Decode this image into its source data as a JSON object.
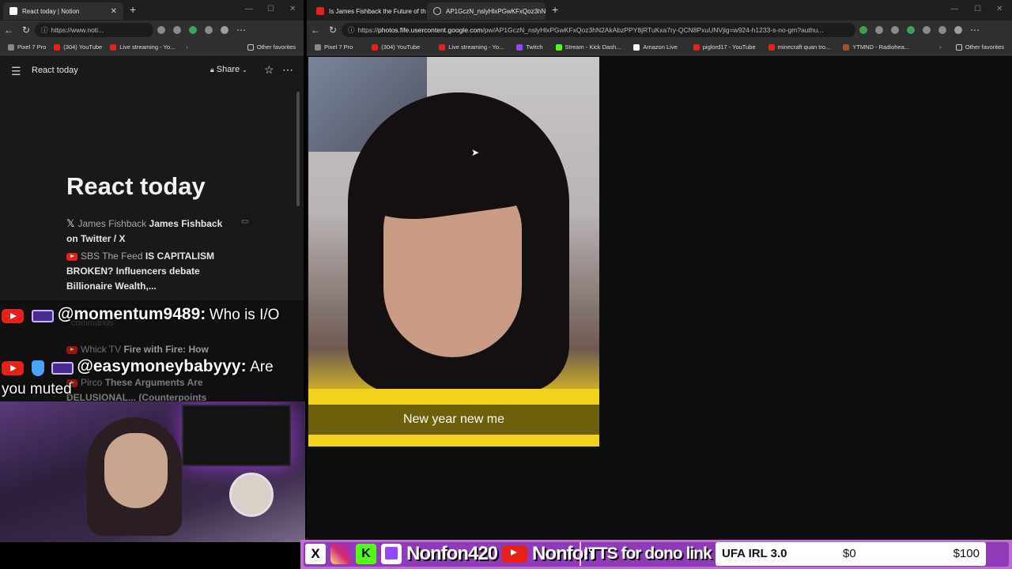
{
  "left_window": {
    "tab_title": "React today | Notion",
    "url": "https://www.noti...",
    "bookmarks": [
      "Pixel 7 Pro",
      "(304) YouTube",
      "Live streaming - Yo...",
      "Other favorites"
    ],
    "notion": {
      "breadcrumb": "React today",
      "share_label": "Share",
      "page_title": "React today",
      "items": [
        {
          "source": "James Fishback",
          "title": "James Fishback on Twitter / X"
        },
        {
          "source": "SBS The Feed",
          "title": "IS CAPITALISM BROKEN? Influencers debate Billionaire Wealth,..."
        },
        {
          "source": "Whick TV",
          "title": "Fire with Fire: How"
        },
        {
          "source": "Pirco",
          "title": "These Arguments Are DELUSIONAL... (Counterpoints"
        }
      ],
      "hidden_line": "commands"
    }
  },
  "right_window": {
    "tabs": [
      {
        "label": "Is James Fishback the Future of th"
      },
      {
        "label": "AP1GczN_nslyHlxPGwKFxQoz3hN"
      }
    ],
    "url_prefix": "https://",
    "url_host": "photos.fife.usercontent.google.com",
    "url_rest": "/pw/AP1GczN_nslyHlxPGwKFxQoz3hN2AkAbzPPY8jRTuKxa7ry-QCN8PxuUNVjig=w924-h1233-s-no-gm?authu...",
    "bookmarks": [
      "Pixel 7 Pro",
      "(304) YouTube",
      "Live streaming - Yo...",
      "Twitch",
      "Stream - Kick Dash...",
      "Amazon Live",
      "piglord17 - YouTube",
      "minecraft quan tro...",
      "YTMND - Radiohea...",
      "Other favorites"
    ],
    "image_caption": "New year new me"
  },
  "chat": [
    {
      "user": "@momentum9489:",
      "message": "Who is I/O"
    },
    {
      "user": "@easymoneybabyyy:",
      "message": "Are you muted"
    }
  ],
  "stream_bar": {
    "handle1": "Nonfon420",
    "handle2": "Nonfon",
    "tts_label": "!TTS for dono link",
    "goal_label": "UFA IRL 3.0",
    "goal_current": "$0",
    "goal_target": "$100",
    "goal_progress": 0
  }
}
